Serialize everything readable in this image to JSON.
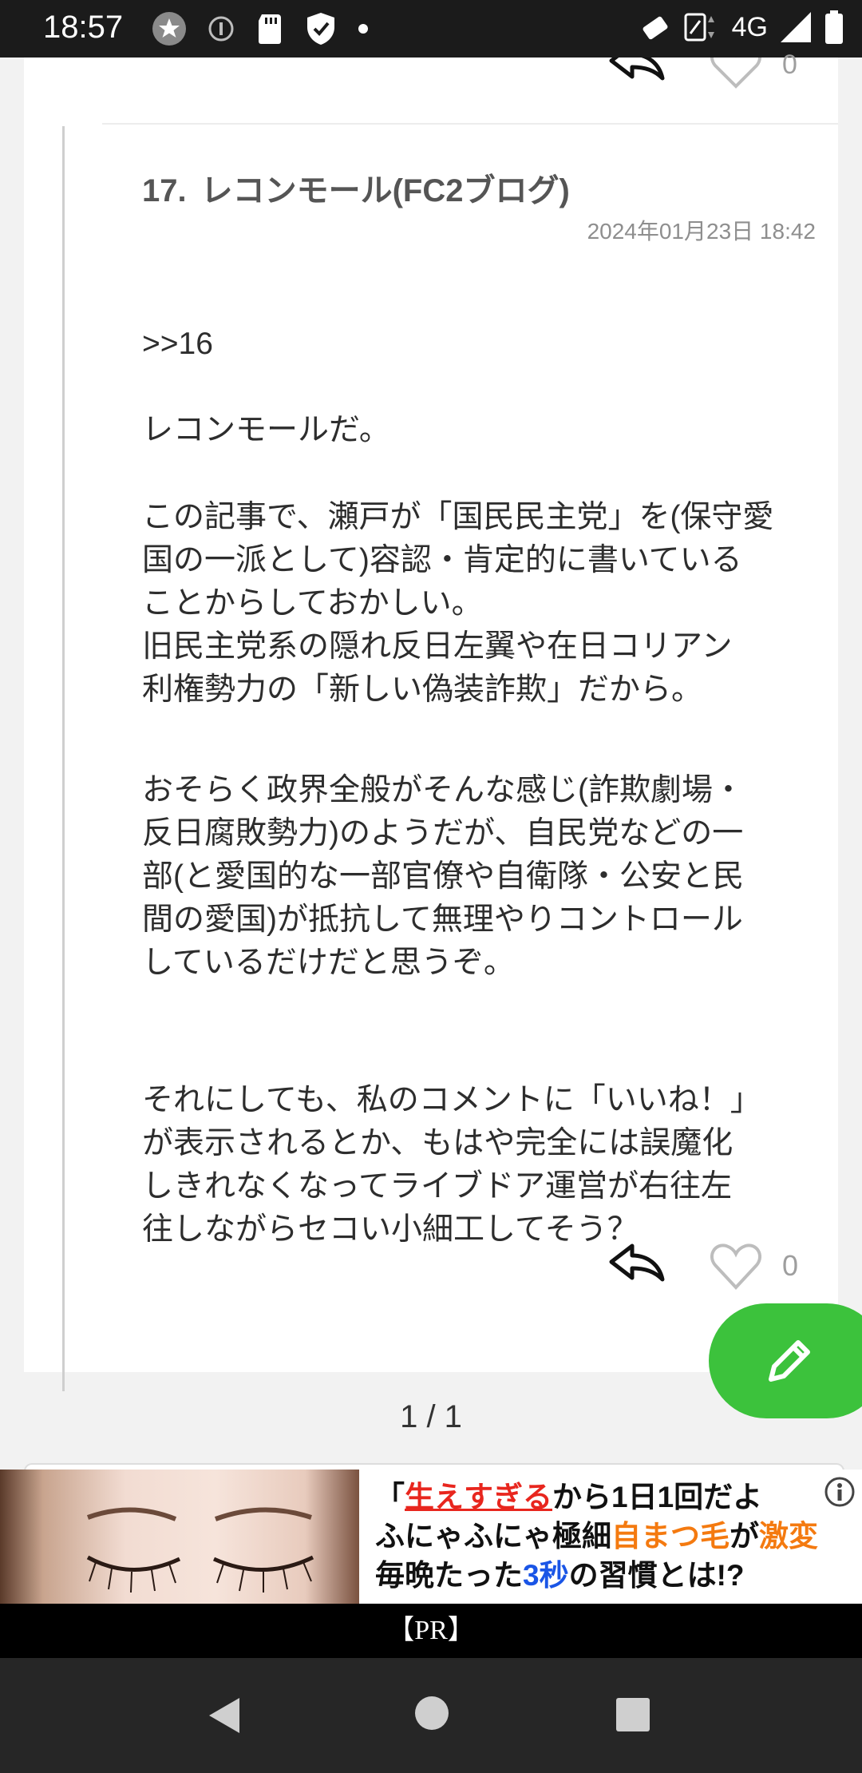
{
  "status_bar": {
    "time": "18:57",
    "network": "4G",
    "icons": [
      "star-icon",
      "info-icon",
      "sd-card-icon",
      "shield-icon",
      "dot-icon",
      "auto-rotate-icon",
      "nfc-icon",
      "signal-icon",
      "battery-icon"
    ]
  },
  "previous_comment": {
    "like_count": "0"
  },
  "comment": {
    "number": "17.",
    "author": "レコンモール(FC2ブログ)",
    "date": "2024年01月23日 18:42",
    "quote": ">>16",
    "para1": "レコンモールだ。",
    "para2": "この記事で、瀬戸が「国民民主党」を(保守愛\n国の一派として)容認・肯定的に書いている\nことからしておかしい。\n旧民主党系の隠れ反日左翼や在日コリアン\n利権勢力の「新しい偽装詐欺」だから。",
    "para3": "おそらく政界全般がそんな感じ(詐欺劇場・\n反日腐敗勢力)のようだが、自民党などの一\n部(と愛国的な一部官僚や自衛隊・公安と民\n間の愛国)が抵抗して無理やりコントロール\nしているだけだと思うぞ。",
    "para4": "それにしても、私のコメントに「いいね！」\nが表示されるとか、もはや完全には誤魔化\nしきれなくなってライブドア運営が右往左\n往しながらセコい小細工してそう？",
    "like_count": "0"
  },
  "pager": {
    "text": "1 / 1"
  },
  "ad": {
    "line1": {
      "a": "「",
      "b": "生えすぎる",
      "c": "から1日1回だよ"
    },
    "line2": {
      "a": "ふにゃふにゃ極細",
      "b": "自まつ毛",
      "c": "が",
      "d": "激変"
    },
    "line3": {
      "a": "毎晩たった",
      "b": "3秒",
      "c": "の習慣とは!?"
    },
    "pr_label": "【PR】"
  },
  "colors": {
    "fab": "#3cc23c",
    "ad_red": "#e8261e",
    "ad_orange": "#f47a10",
    "ad_blue": "#1a55e6"
  }
}
